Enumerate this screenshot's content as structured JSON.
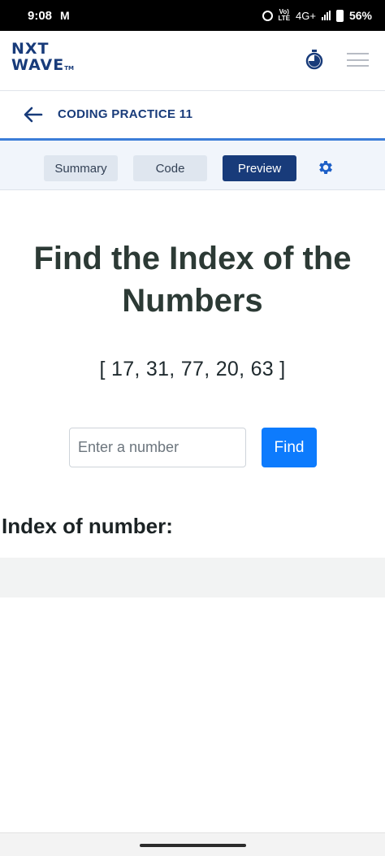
{
  "status_bar": {
    "time": "9:08",
    "carrier_icon": "M",
    "volte": "Vo)\nLTE",
    "network": "4G+",
    "battery": "56%"
  },
  "header": {
    "logo_line1": "NXT",
    "logo_line2": "WAVE",
    "logo_tm": "TM",
    "icons": [
      "timer-icon",
      "menu-icon"
    ]
  },
  "breadcrumb": {
    "title": "CODING PRACTICE 11"
  },
  "tabs": {
    "summary": "Summary",
    "code": "Code",
    "preview": "Preview",
    "active": "Preview"
  },
  "preview": {
    "heading": "Find the Index of the Numbers",
    "numbers": "[ 17, 31, 77, 20, 63 ]",
    "input_placeholder": "Enter a number",
    "input_value": "",
    "find_button": "Find",
    "index_label": "Index of number:",
    "result": ""
  },
  "colors": {
    "brand": "#183b7a",
    "accent": "#0d7bfd",
    "heading": "#2c3a35"
  }
}
